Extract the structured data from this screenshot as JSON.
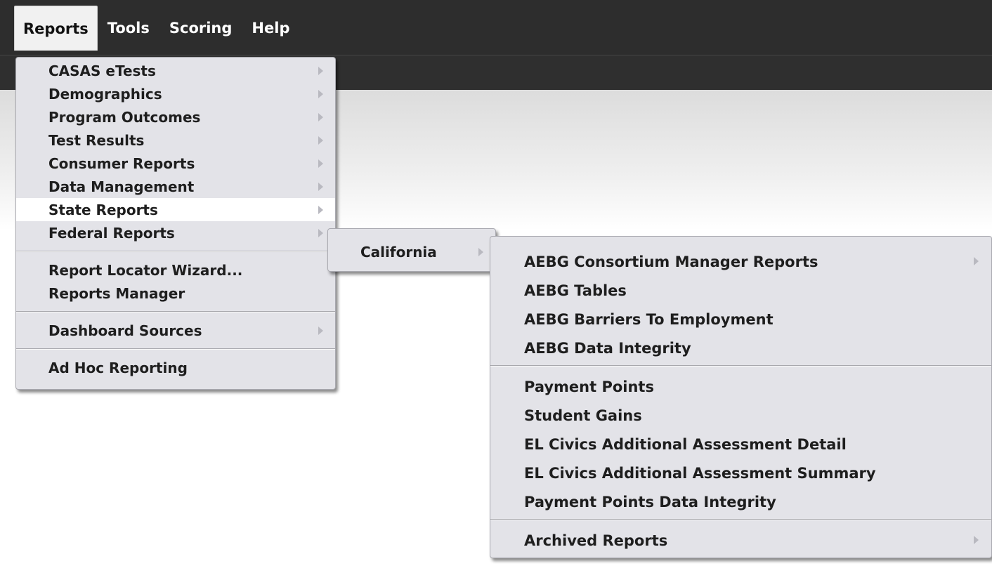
{
  "menubar": {
    "items": [
      {
        "label": "Reports",
        "active": true
      },
      {
        "label": "Tools"
      },
      {
        "label": "Scoring"
      },
      {
        "label": "Help"
      }
    ]
  },
  "reports_menu": {
    "group1": [
      "CASAS eTests",
      "Demographics",
      "Program Outcomes",
      "Test Results",
      "Consumer Reports",
      "Data Management",
      "State Reports",
      "Federal Reports"
    ],
    "group2": [
      "Report Locator Wizard...",
      "Reports Manager"
    ],
    "group3": [
      "Dashboard Sources"
    ],
    "group4": [
      "Ad Hoc Reporting"
    ]
  },
  "state_reports_menu": {
    "items": [
      "California"
    ]
  },
  "california_menu": {
    "group1": [
      "AEBG Consortium Manager Reports",
      "AEBG Tables",
      "AEBG Barriers To Employment",
      "AEBG Data Integrity"
    ],
    "group2": [
      "Payment Points",
      "Student Gains",
      "EL Civics Additional Assessment Detail",
      "EL Civics Additional Assessment Summary",
      "Payment Points Data Integrity"
    ],
    "group3": [
      "Archived Reports"
    ]
  },
  "colors": {
    "topbar": "#2d2d2d",
    "menu_bg": "#e3e3e8",
    "highlight": "#ffffff",
    "text": "#1e1e1e"
  }
}
